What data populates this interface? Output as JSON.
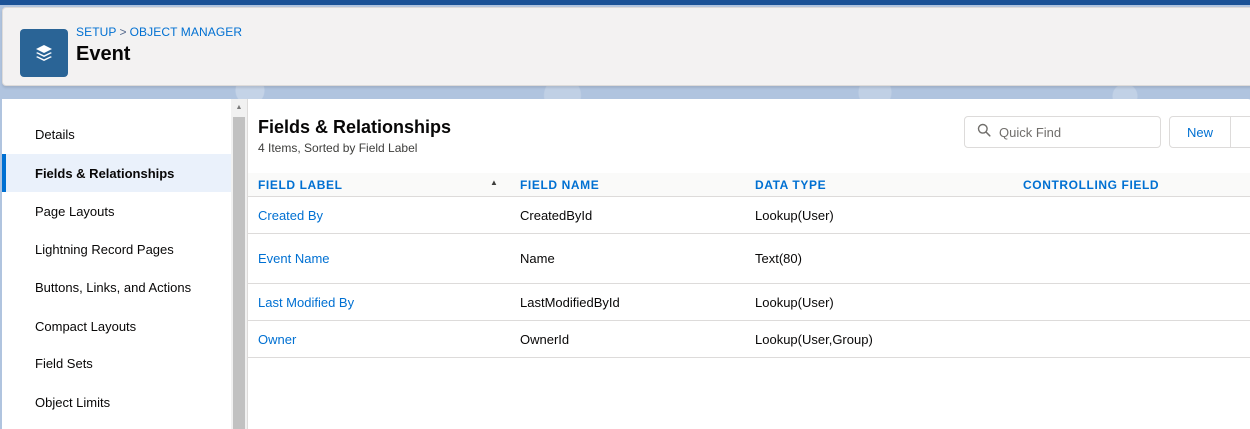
{
  "header": {
    "breadcrumb": [
      "SETUP",
      "OBJECT MANAGER"
    ],
    "breadcrumb_separator": ">",
    "title": "Event",
    "icon": "layers-icon"
  },
  "sidebar": {
    "items": [
      {
        "label": "Details",
        "active": false
      },
      {
        "label": "Fields & Relationships",
        "active": true
      },
      {
        "label": "Page Layouts",
        "active": false
      },
      {
        "label": "Lightning Record Pages",
        "active": false
      },
      {
        "label": "Buttons, Links, and Actions",
        "active": false
      },
      {
        "label": "Compact Layouts",
        "active": false
      },
      {
        "label": "Field Sets",
        "active": false
      },
      {
        "label": "Object Limits",
        "active": false
      }
    ]
  },
  "main": {
    "title": "Fields & Relationships",
    "subtitle": "4 Items, Sorted by Field Label",
    "search": {
      "placeholder": "Quick Find",
      "value": ""
    },
    "new_button": "New",
    "table": {
      "columns": [
        "FIELD LABEL",
        "FIELD NAME",
        "DATA TYPE",
        "CONTROLLING FIELD"
      ],
      "sorted_column": "FIELD LABEL",
      "rows": [
        {
          "field_label": "Created By",
          "field_name": "CreatedById",
          "data_type": "Lookup(User)",
          "controlling_field": ""
        },
        {
          "field_label": "Event Name",
          "field_name": "Name",
          "data_type": "Text(80)",
          "controlling_field": ""
        },
        {
          "field_label": "Last Modified By",
          "field_name": "LastModifiedById",
          "data_type": "Lookup(User)",
          "controlling_field": ""
        },
        {
          "field_label": "Owner",
          "field_name": "OwnerId",
          "data_type": "Lookup(User,Group)",
          "controlling_field": ""
        }
      ]
    }
  },
  "colors": {
    "brand": "#0070d2",
    "object_icon": "#2a6496",
    "active_item_bg": "#eaf1fb"
  }
}
